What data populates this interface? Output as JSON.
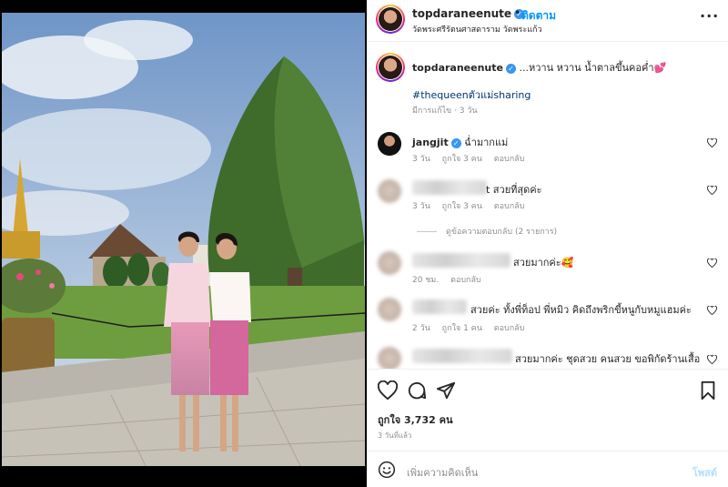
{
  "post": {
    "username": "topdaraneenute",
    "follow_label": "ติดตาม",
    "location": "วัดพระศรีรัตนศาสดาราม วัดพระแก้ว",
    "more_icon": "more-horizontal-icon"
  },
  "caption": {
    "username": "topdaraneenute",
    "text": "...หวาน หวาน น้ำตาลขึ้นคอค่ำ💕",
    "hashtag": "#thequeenตัวแม่sharing",
    "meta": "มีการแก้ไข · 3 วัน"
  },
  "comments": [
    {
      "username": "jangjit",
      "text": "ฉ่ำมากแม่",
      "time": "3 วัน",
      "likes": "ถูกใจ 3 คน",
      "reply": "ตอบกลับ"
    },
    {
      "username": "",
      "text": "t สวยที่สุดค่ะ",
      "time": "3 วัน",
      "likes": "ถูกใจ 3 คน",
      "reply": "ตอบกลับ",
      "view_replies": "ดูข้อความตอบกลับ (2 รายการ)"
    },
    {
      "username": "",
      "text": "สวยมากค่ะ🥰",
      "time": "20 ชม.",
      "likes": "",
      "reply": "ตอบกลับ"
    },
    {
      "username": "",
      "text": "สวยค่ะ ทั้งพี่ท็อป พี่หมิว คิดถึงพริกขี้หนูกับหมูแฮมค่ะ",
      "time": "2 วัน",
      "likes": "ถูกใจ 1 คน",
      "reply": "ตอบกลับ"
    },
    {
      "username": "",
      "text": "สวยมากค่ะ ชุดสวย คนสวย ขอพิกัดร้านเสื้อ",
      "time": "",
      "likes": "",
      "reply": ""
    }
  ],
  "actions": {
    "likes_count": "ถูกใจ 3,732 คน",
    "date": "3 วันที่แล้ว"
  },
  "composer": {
    "placeholder": "เพิ่มความคิดเห็น",
    "post_label": "โพสต์"
  },
  "colors": {
    "accent": "#0095f6",
    "link": "#00376b",
    "muted": "#8e8e8e"
  }
}
